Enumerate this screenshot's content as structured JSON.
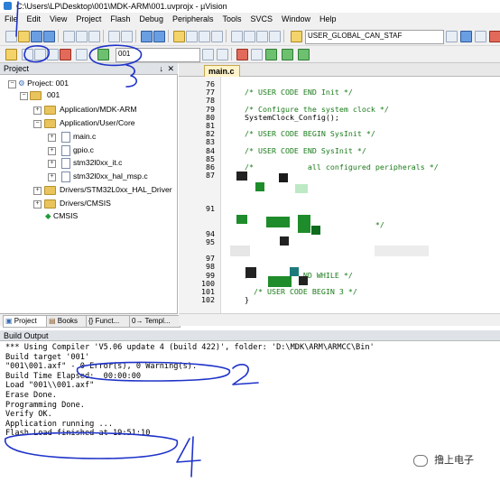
{
  "window": {
    "title": "C:\\Users\\LP\\Desktop\\001\\MDK-ARM\\001.uvprojx - µVision"
  },
  "menu": [
    "File",
    "Edit",
    "View",
    "Project",
    "Flash",
    "Debug",
    "Peripherals",
    "Tools",
    "SVCS",
    "Window",
    "Help"
  ],
  "toolbar": {
    "define_combo": "USER_GLOBAL_CAN_STAF",
    "target_combo": "001"
  },
  "project_panel": {
    "header": "Project",
    "tree": [
      {
        "label": "Project: 001",
        "type": "project"
      },
      {
        "label": "001",
        "type": "target"
      },
      {
        "label": "Application/MDK-ARM",
        "type": "group"
      },
      {
        "label": "Application/User/Core",
        "type": "group"
      },
      {
        "label": "main.c",
        "type": "file"
      },
      {
        "label": "gpio.c",
        "type": "file"
      },
      {
        "label": "stm32l0xx_it.c",
        "type": "file"
      },
      {
        "label": "stm32l0xx_hal_msp.c",
        "type": "file"
      },
      {
        "label": "Drivers/STM32L0xx_HAL_Driver",
        "type": "group"
      },
      {
        "label": "Drivers/CMSIS",
        "type": "group"
      },
      {
        "label": "CMSIS",
        "type": "component"
      }
    ],
    "tabs": [
      "Project",
      "Books",
      "{} Funct...",
      "0→ Templ..."
    ]
  },
  "editor": {
    "tab": "main.c",
    "lines": [
      {
        "n": "76",
        "text": ""
      },
      {
        "n": "77",
        "text": "  /* USER CODE END Init */"
      },
      {
        "n": "78",
        "text": ""
      },
      {
        "n": "79",
        "text": "  /* Configure the system clock */"
      },
      {
        "n": "80",
        "text": "  SystemClock_Config();"
      },
      {
        "n": "81",
        "text": ""
      },
      {
        "n": "82",
        "text": "  /* USER CODE BEGIN SysInit */"
      },
      {
        "n": "83",
        "text": ""
      },
      {
        "n": "84",
        "text": "  /* USER CODE END SysInit */"
      },
      {
        "n": "85",
        "text": ""
      },
      {
        "n": "86",
        "text": "  /*            all configured peripherals */"
      },
      {
        "n": "87",
        "text": ""
      },
      {
        "n": "",
        "text": ""
      },
      {
        "n": "",
        "text": ""
      },
      {
        "n": "",
        "text": ""
      },
      {
        "n": "91",
        "text": ""
      },
      {
        "n": "",
        "text": ""
      },
      {
        "n": "",
        "text": "                               */"
      },
      {
        "n": "94",
        "text": ""
      },
      {
        "n": "95",
        "text": ""
      },
      {
        "n": "",
        "text": ""
      },
      {
        "n": "97",
        "text": ""
      },
      {
        "n": "98",
        "text": ""
      },
      {
        "n": "99",
        "text": "  /            ND WHILE */"
      },
      {
        "n": "100",
        "text": ""
      },
      {
        "n": "101",
        "text": "    /* USER CODE BEGIN 3 */"
      },
      {
        "n": "102",
        "text": "  }"
      }
    ]
  },
  "build_output": {
    "header": "Build Output",
    "lines": [
      "*** Using Compiler 'V5.06 update 4 (build 422)', folder: 'D:\\MDK\\ARM\\ARMCC\\Bin'",
      "Build target '001'",
      "\"001\\001.axf\" - 0 Error(s), 0 Warning(s).",
      "Build Time Elapsed:  00:00:00",
      "Load \"001\\\\001.axf\"",
      "Erase Done.",
      "Programming Done.",
      "Verify OK.",
      "Application running ...",
      "Flash Load finished at 19:51:10"
    ]
  },
  "watermark": {
    "text": "撸上电子"
  },
  "colors": {
    "annotation": "#1f33c9",
    "comment": "#1b7a1b",
    "folder": "#e9c45c"
  }
}
